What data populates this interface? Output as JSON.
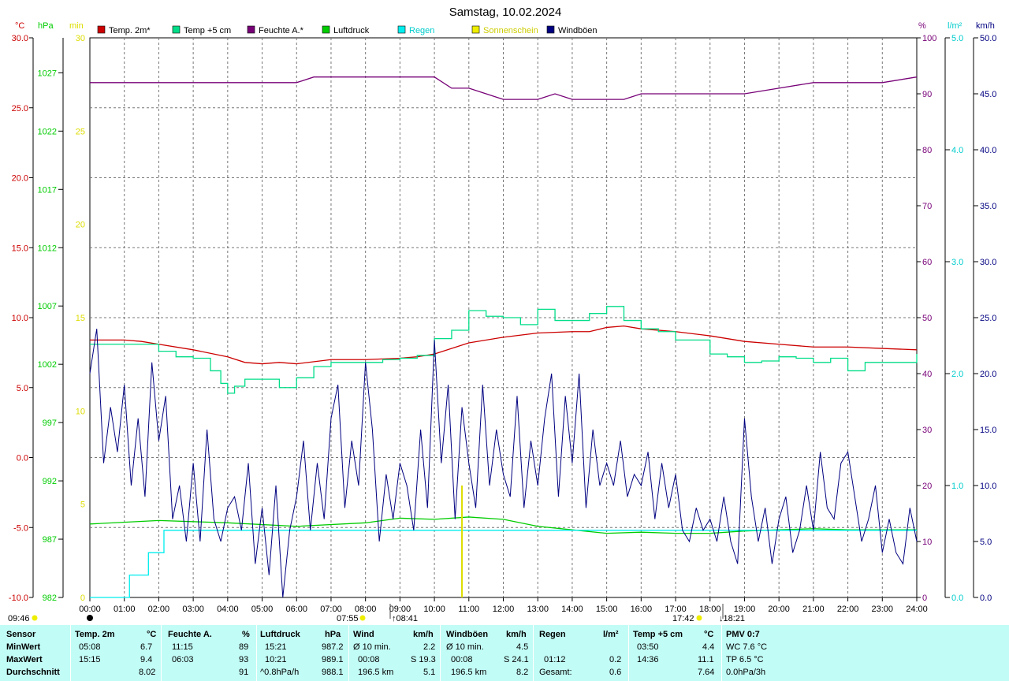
{
  "title": "Samstag, 10.02.2024",
  "colors": {
    "temp2m": "#cc0000",
    "temp5cm": "#00dd88",
    "humidity": "#770077",
    "pressure": "#00cc00",
    "rain": "#00eeee",
    "sunshine": "#eeee00",
    "gust": "#000080",
    "stats_bg": "#c2fcf6"
  },
  "legend": [
    {
      "label": "Temp. 2m*",
      "color": "#cc0000"
    },
    {
      "label": "Temp +5 cm",
      "color": "#00dd88"
    },
    {
      "label": "Feuchte A.*",
      "color": "#770077"
    },
    {
      "label": "Luftdruck",
      "color": "#00cc00"
    },
    {
      "label": "Regen",
      "color": "#00eeee"
    },
    {
      "label": "Sonnenschein",
      "color": "#eeee00"
    },
    {
      "label": "Windböen",
      "color": "#000080"
    }
  ],
  "units": {
    "temp": "°C",
    "pressure": "hPa",
    "sun": "min",
    "humidity": "%",
    "rain": "l/m²",
    "wind": "km/h"
  },
  "axes": {
    "temp_ticks": [
      "30.0",
      "25.0",
      "20.0",
      "15.0",
      "10.0",
      "5.0",
      "0.0",
      "-5.0",
      "-10.0"
    ],
    "pressure_ticks": [
      "1027",
      "1022",
      "1017",
      "1012",
      "1007",
      "1002",
      "997",
      "992",
      "987",
      "982"
    ],
    "sun_ticks": [
      "30",
      "25",
      "20",
      "15",
      "10",
      "5",
      "0"
    ],
    "humidity_ticks": [
      "100",
      "90",
      "80",
      "70",
      "60",
      "50",
      "40",
      "30",
      "20",
      "10",
      "0"
    ],
    "rain_ticks": [
      "5.0",
      "4.0",
      "3.0",
      "2.0",
      "1.0",
      "0.0"
    ],
    "wind_ticks": [
      "50.0",
      "45.0",
      "40.0",
      "35.0",
      "30.0",
      "25.0",
      "20.0",
      "15.0",
      "10.0",
      "5.0",
      "0.0"
    ],
    "time_ticks": [
      "00:00",
      "01:00",
      "02:00",
      "03:00",
      "04:00",
      "05:00",
      "06:00",
      "07:00",
      "08:00",
      "09:00",
      "10:00",
      "11:00",
      "12:00",
      "13:00",
      "14:00",
      "15:00",
      "16:00",
      "17:00",
      "18:00",
      "19:00",
      "20:00",
      "21:00",
      "22:00",
      "23:00",
      "24:00"
    ]
  },
  "markers": {
    "daylight_start": "09:46",
    "sunrise": "07:55",
    "sun_start": "08:41",
    "sunset": "17:42",
    "sun_end": "18:21"
  },
  "chart_data": {
    "type": "line",
    "title": "Samstag, 10.02.2024",
    "x_range_hours": [
      0,
      24
    ],
    "temp_range": [
      -10,
      30
    ],
    "pressure_range": [
      982,
      1030
    ],
    "sun_range": [
      0,
      30
    ],
    "humidity_range": [
      0,
      100
    ],
    "rain_range": [
      0,
      5
    ],
    "wind_range": [
      0,
      50
    ],
    "grid": true,
    "legend_position": "top",
    "series": [
      {
        "name": "Temp. 2m*",
        "axis": "temp",
        "x": [
          0,
          1,
          1.5,
          2,
          3,
          4,
          4.5,
          5,
          5.5,
          6,
          7,
          7.5,
          8,
          9,
          9.5,
          10,
          11,
          12,
          13,
          14,
          14.5,
          15,
          15.5,
          16,
          17,
          18,
          19,
          20,
          21,
          22,
          23,
          24
        ],
        "y": [
          8.4,
          8.4,
          8.3,
          8.1,
          7.7,
          7.2,
          6.8,
          6.7,
          6.8,
          6.7,
          7.0,
          7.0,
          7.0,
          7.1,
          7.2,
          7.4,
          8.2,
          8.6,
          8.9,
          9.0,
          9.0,
          9.3,
          9.4,
          9.2,
          9.0,
          8.7,
          8.3,
          8.1,
          7.9,
          7.9,
          7.8,
          7.7
        ]
      },
      {
        "name": "Temp +5 cm",
        "axis": "temp",
        "x": [
          0,
          1,
          1.5,
          2,
          2.5,
          3,
          3.5,
          3.8,
          4,
          4.2,
          4.5,
          5,
          5.5,
          6,
          6.5,
          7,
          7.5,
          8,
          8.5,
          9,
          9.5,
          10,
          10.5,
          11,
          11.5,
          12,
          12.5,
          13,
          13.5,
          14,
          14.5,
          15,
          15.5,
          16,
          16.5,
          17,
          17.5,
          18,
          18.5,
          19,
          19.5,
          20,
          20.5,
          21,
          21.5,
          22,
          22.5,
          23,
          23.5,
          24
        ],
        "y": [
          8.1,
          8.1,
          8.1,
          7.6,
          7.2,
          7.1,
          6.2,
          5.3,
          4.6,
          5.1,
          5.6,
          5.6,
          5.0,
          5.7,
          6.5,
          6.8,
          6.8,
          6.8,
          7.0,
          7.1,
          7.3,
          8.5,
          9.1,
          10.5,
          10.1,
          10.0,
          9.5,
          10.6,
          9.8,
          9.8,
          10.3,
          10.8,
          9.8,
          9.2,
          9.0,
          8.4,
          8.4,
          7.4,
          7.2,
          6.8,
          6.9,
          7.2,
          7.1,
          6.8,
          7.1,
          6.2,
          6.8,
          6.8,
          6.8,
          7.4
        ]
      },
      {
        "name": "Feuchte A.*",
        "axis": "humidity",
        "x": [
          0,
          6,
          6.5,
          7,
          10,
          10.5,
          11,
          11.5,
          12,
          13,
          13.5,
          14,
          15,
          15.5,
          16,
          17,
          18,
          18.5,
          19,
          20,
          21,
          22,
          23,
          24
        ],
        "y": [
          92,
          92,
          93,
          93,
          93,
          91,
          91,
          90,
          89,
          89,
          90,
          89,
          89,
          89,
          90,
          90,
          90,
          90,
          90,
          91,
          92,
          92,
          92,
          93
        ]
      },
      {
        "name": "Luftdruck",
        "axis": "pressure",
        "x": [
          0,
          2,
          4,
          6,
          8,
          9,
          10,
          11,
          12,
          13,
          14,
          15,
          16,
          17,
          18,
          19,
          20,
          21,
          22,
          23,
          24
        ],
        "y": [
          988.3,
          988.6,
          988.4,
          988.1,
          988.4,
          988.8,
          988.7,
          988.9,
          988.7,
          988.1,
          987.8,
          987.5,
          987.6,
          987.5,
          987.5,
          987.7,
          987.8,
          987.9,
          987.8,
          987.8,
          987.8
        ]
      },
      {
        "name": "Regen",
        "axis": "rain",
        "x": [
          0,
          1.15,
          1.15,
          1.7,
          1.7,
          2.15,
          2.15,
          24
        ],
        "y": [
          0,
          0,
          0.2,
          0.2,
          0.4,
          0.4,
          0.6,
          0.6
        ]
      },
      {
        "name": "Sonnenschein",
        "axis": "sun",
        "x": [
          10.8
        ],
        "y": [
          6
        ]
      },
      {
        "name": "Windböen",
        "axis": "wind",
        "x": [
          0,
          0.2,
          0.4,
          0.6,
          0.8,
          1.0,
          1.2,
          1.4,
          1.6,
          1.8,
          2.0,
          2.2,
          2.4,
          2.6,
          2.8,
          3.0,
          3.2,
          3.4,
          3.6,
          3.8,
          4.0,
          4.2,
          4.4,
          4.6,
          4.8,
          5.0,
          5.2,
          5.4,
          5.6,
          5.8,
          6.0,
          6.2,
          6.4,
          6.6,
          6.8,
          7.0,
          7.2,
          7.4,
          7.6,
          7.8,
          8.0,
          8.2,
          8.4,
          8.6,
          8.8,
          9.0,
          9.2,
          9.4,
          9.6,
          9.8,
          10.0,
          10.2,
          10.4,
          10.6,
          10.8,
          11.0,
          11.2,
          11.4,
          11.6,
          11.8,
          12.0,
          12.2,
          12.4,
          12.6,
          12.8,
          13.0,
          13.2,
          13.4,
          13.6,
          13.8,
          14.0,
          14.2,
          14.4,
          14.6,
          14.8,
          15.0,
          15.2,
          15.4,
          15.6,
          15.8,
          16.0,
          16.2,
          16.4,
          16.6,
          16.8,
          17.0,
          17.2,
          17.4,
          17.6,
          17.8,
          18.0,
          18.2,
          18.4,
          18.6,
          18.8,
          19.0,
          19.2,
          19.4,
          19.6,
          19.8,
          20.0,
          20.2,
          20.4,
          20.6,
          20.8,
          21.0,
          21.2,
          21.4,
          21.6,
          21.8,
          22.0,
          22.2,
          22.4,
          22.6,
          22.8,
          23.0,
          23.2,
          23.4,
          23.6,
          23.8,
          24.0
        ],
        "y": [
          20,
          24,
          12,
          17,
          13,
          19,
          10,
          16,
          9,
          21,
          14,
          18,
          7,
          10,
          5,
          12,
          5,
          15,
          7,
          5,
          8,
          9,
          6,
          12,
          3,
          8,
          2,
          10,
          0,
          6,
          9,
          14,
          6,
          12,
          7,
          16,
          19,
          8,
          14,
          10,
          21,
          15,
          5,
          11,
          7,
          12,
          10,
          6,
          15,
          8,
          23,
          12,
          19,
          7,
          17,
          12,
          8,
          19,
          10,
          15,
          11,
          9,
          18,
          8,
          14,
          10,
          16,
          20,
          9,
          18,
          12,
          20,
          8,
          15,
          10,
          12,
          10,
          14,
          9,
          11,
          10,
          13,
          7,
          12,
          8,
          11,
          6,
          5,
          8,
          6,
          7,
          5,
          9,
          5,
          3,
          16,
          9,
          5,
          8,
          3,
          7,
          9,
          4,
          6,
          10,
          6,
          13,
          8,
          7,
          12,
          13,
          9,
          5,
          7,
          10,
          4,
          7,
          4,
          3,
          8,
          5
        ]
      }
    ]
  },
  "stats": {
    "row_labels": [
      "Sensor",
      "MinWert",
      "MaxWert",
      "Durchschnitt"
    ],
    "temp": {
      "header": "Temp. 2m",
      "unit": "°C",
      "min_time": "05:08",
      "min_val": "6.7",
      "max_time": "15:15",
      "max_val": "9.4",
      "avg": "8.02"
    },
    "humidity": {
      "header": "Feuchte A.",
      "unit": "%",
      "min_time": "11:15",
      "min_val": "89",
      "max_time": "06:03",
      "max_val": "93",
      "avg": "91"
    },
    "pressure": {
      "header": "Luftdruck",
      "unit": "hPa",
      "min_time": "15:21",
      "min_val": "987.2",
      "max_time": "10:21",
      "max_val": "989.1",
      "trend": "^0.8hPa/h",
      "avg": "988.1"
    },
    "wind": {
      "header": "Wind",
      "unit": "km/h",
      "min_label": "Ø 10 min.",
      "min_val": "2.2",
      "max_time": "00:08",
      "max_val": "S 19.3",
      "distance": "196.5 km",
      "avg": "5.1"
    },
    "gust": {
      "header": "Windböen",
      "unit": "km/h",
      "min_label": "Ø 10 min.",
      "min_val": "4.5",
      "max_time": "00:08",
      "max_val": "S 24.1",
      "distance": "196.5 km",
      "avg": "8.2"
    },
    "rain": {
      "header": "Regen",
      "unit": "l/m²",
      "max_time": "01:12",
      "max_val": "0.2",
      "total_label": "Gesamt:",
      "total": "0.6"
    },
    "temp5": {
      "header": "Temp +5 cm",
      "unit": "°C",
      "min_time": "03:50",
      "min_val": "4.4",
      "max_time": "14:36",
      "max_val": "11.1",
      "avg": "7.64"
    },
    "pmv": {
      "header": "PMV 0:7",
      "line1": "WC 7.6 °C",
      "line2": "TP 6.5 °C",
      "line3": "0.0hPa/3h"
    }
  }
}
